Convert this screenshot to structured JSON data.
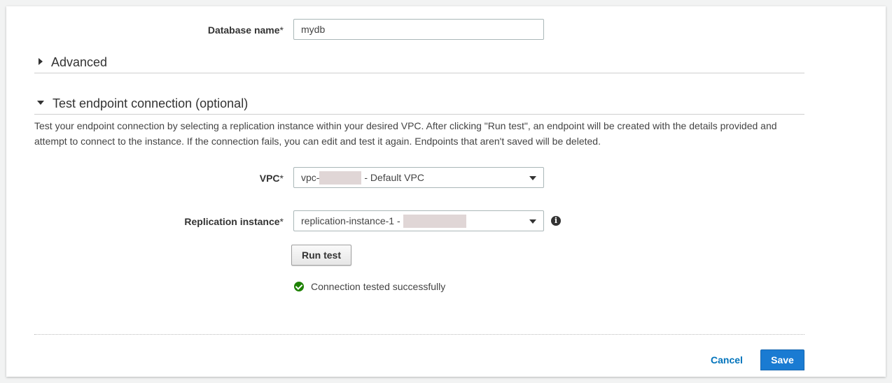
{
  "database_name": {
    "label": "Database name",
    "required_mark": "*",
    "value": "mydb"
  },
  "advanced_section": {
    "title": "Advanced",
    "expanded": false
  },
  "test_section": {
    "title": "Test endpoint connection (optional)",
    "expanded": true,
    "description": "Test your endpoint connection by selecting a replication instance within your desired VPC. After clicking \"Run test\", an endpoint will be created with the details provided and attempt to connect to the instance. If the connection fails, you can edit and test it again. Endpoints that aren't saved will be deleted."
  },
  "vpc": {
    "label": "VPC",
    "required_mark": "*",
    "value_prefix": "vpc-",
    "value_suffix": " - Default VPC"
  },
  "replication_instance": {
    "label": "Replication instance",
    "required_mark": "*",
    "value_prefix": "replication-instance-1 - "
  },
  "run_test_button": "Run test",
  "status": {
    "text": "Connection tested successfully",
    "color": "#1d8102"
  },
  "footer": {
    "cancel_label": "Cancel",
    "save_label": "Save",
    "accent_color": "#1a7bd2"
  }
}
